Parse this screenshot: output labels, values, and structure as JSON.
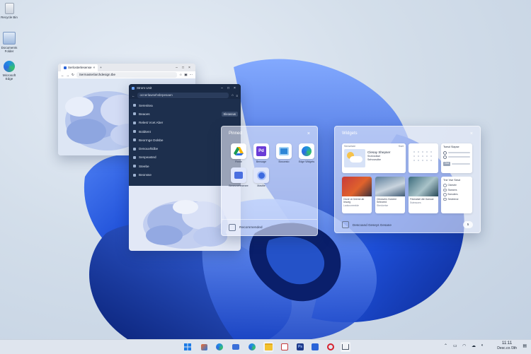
{
  "desktop": {
    "icons": [
      {
        "name": "recycle-bin-icon",
        "label": "Recycle Bin"
      },
      {
        "name": "documents-icon",
        "label": "Documents Folder"
      },
      {
        "name": "edge-icon",
        "label": "Microsoft Edge"
      }
    ]
  },
  "browser_light": {
    "tab_title": "Serlosterlesense",
    "url": "Sermasterlarchdesign.tbe"
  },
  "browser_dark": {
    "tab_title": "Strom Unit",
    "url": "ocnerlawsehsbrpesaen",
    "menu": [
      {
        "label": "Serenitea",
        "pill": ""
      },
      {
        "label": "Beaoes",
        "pill": "Sleoeeus"
      },
      {
        "label": "Relest Vcet Aber",
        "pill": ""
      },
      {
        "label": "Boldtent",
        "pill": ""
      },
      {
        "label": "Beorrnge Dolsbe",
        "pill": ""
      },
      {
        "label": "Denouvhldbe",
        "pill": ""
      },
      {
        "label": "Senpeasted",
        "pill": ""
      },
      {
        "label": "Steebe",
        "pill": ""
      },
      {
        "label": "Beonsse",
        "pill": ""
      }
    ]
  },
  "start_panel": {
    "title": "Pinned",
    "apps": [
      {
        "label": "Finnle",
        "icon": "drive-icon"
      },
      {
        "label": "Bensage",
        "icon": "photoshop-icon"
      },
      {
        "label": "Bosoesto",
        "icon": "media-icon"
      },
      {
        "label": "Edge Widgets",
        "icon": "edge-icon"
      },
      {
        "label": "Benevoehmenee",
        "icon": "notes-icon"
      },
      {
        "label": "Mastlte",
        "icon": "clock-icon"
      }
    ],
    "recommended": "Recommended"
  },
  "widgets": {
    "title": "Widgets",
    "weather": {
      "header": "Senselare",
      "tag": "Sset",
      "title": "Clesay Shepser",
      "sub": "Snzlcsdsse",
      "detail": "Sehvsrsdbe"
    },
    "cards": [
      {
        "title": "Cluvir ot Geeme ab Iesoeg",
        "sub": "Ladscsreeelde"
      },
      {
        "title": "Clirosvers Goneee Seleceed",
        "sub": "Sbedoetse"
      },
      {
        "title": "Filcmaisel dte Gansoe",
        "sub": "Sstessoes"
      }
    ],
    "todo": {
      "title": "Tne Vse Sesd",
      "items": [
        "Glsesele",
        "Slsesees",
        "Bonsdees",
        "Sesteense"
      ]
    },
    "calendar_title": "Tsesd Slapse",
    "calendar_btn": "Ocd",
    "footer": "Descoand Geseys Gesane",
    "footer_count": "5"
  },
  "taskbar": {
    "time": "11:11",
    "date": "Desc.co /3th"
  }
}
